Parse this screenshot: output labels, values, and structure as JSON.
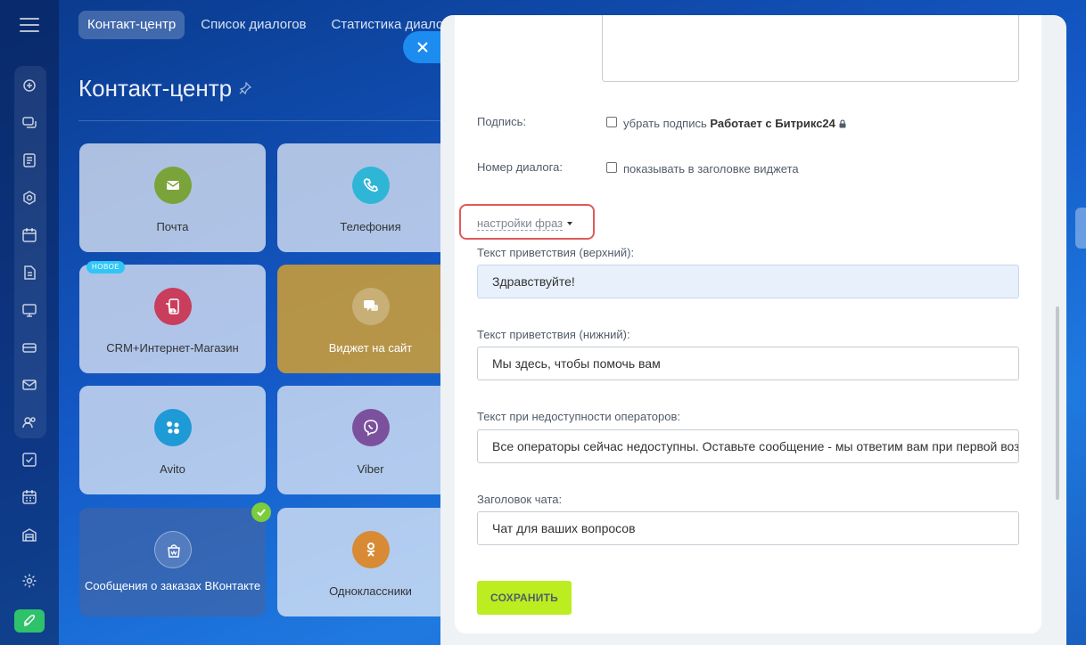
{
  "top_tabs": [
    {
      "label": "Контакт-центр",
      "active": true
    },
    {
      "label": "Список диалогов",
      "active": false
    },
    {
      "label": "Статистика диалогов",
      "active": false
    }
  ],
  "page": {
    "title": "Контакт-центр"
  },
  "tiles": [
    {
      "label": "Почта",
      "color": "#7aa33a",
      "icon": "mail-icon"
    },
    {
      "label": "Телефония",
      "color": "#2fb6d6",
      "icon": "phone-icon"
    },
    {
      "label": "CRM+Интернет-Магазин",
      "color": "#c93d5d",
      "icon": "shop-icon",
      "badge": "НОВОЕ"
    },
    {
      "label": "Виджет на сайт",
      "color": "#d9a53a",
      "icon": "chat-icon"
    },
    {
      "label": "Avito",
      "color": "#1e9ad6",
      "icon": "avito-icon"
    },
    {
      "label": "Viber",
      "color": "#7b519d",
      "icon": "viber-icon"
    },
    {
      "label": "Сообщения о заказах ВКонтакте",
      "color": "#3c5a99",
      "icon": "vk-bag-icon",
      "checked": true
    },
    {
      "label": "Одноклассники",
      "color": "#d88a34",
      "icon": "ok-icon"
    }
  ],
  "form": {
    "signature_label": "Подпись:",
    "signature_checkbox": "убрать подпись ",
    "signature_brand": "Работает с Битрикс24",
    "dialog_number_label": "Номер диалога:",
    "dialog_number_checkbox": "показывать в заголовке виджета",
    "phrase_settings_link": "настройки фраз",
    "greeting_top_label": "Текст приветствия (верхний):",
    "greeting_top_value": "Здравствуйте!",
    "greeting_bottom_label": "Текст приветствия (нижний):",
    "greeting_bottom_value": "Мы здесь, чтобы помочь вам",
    "unavailable_label": "Текст при недоступности операторов:",
    "unavailable_value": "Все операторы сейчас недоступны. Оставьте сообщение - мы ответим вам при первой возможности",
    "chat_title_label": "Заголовок чата:",
    "chat_title_value": "Чат для ваших вопросов",
    "save_label": "СОХРАНИТЬ"
  }
}
